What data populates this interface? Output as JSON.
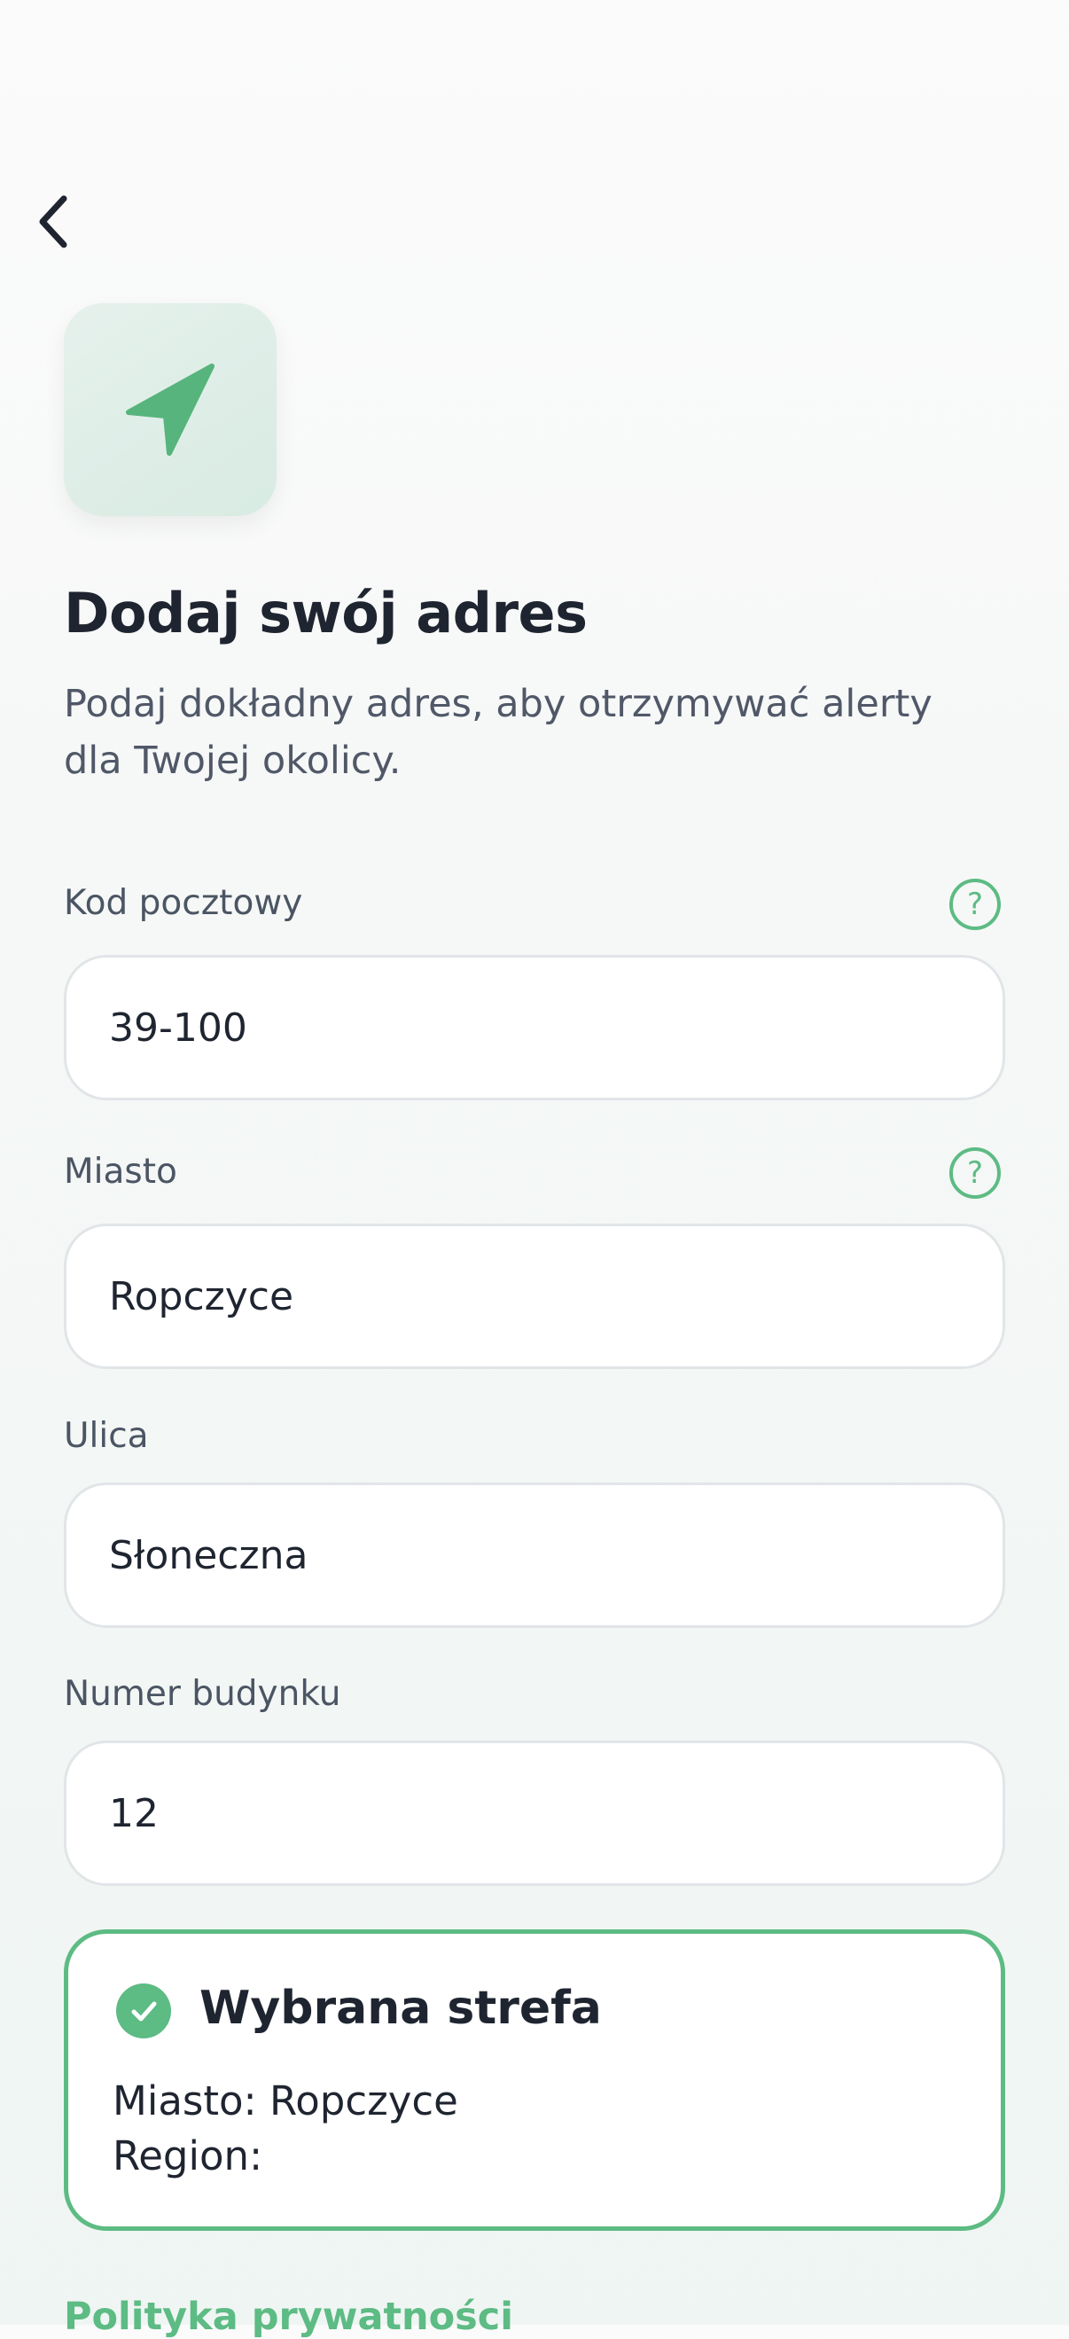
{
  "header": {
    "title": "Dodaj swój adres",
    "subtitle": "Podaj dokładny adres, aby otrzymywać alerty dla Twojej okolicy."
  },
  "form": {
    "postal_code": {
      "label": "Kod pocztowy",
      "value": "39-100"
    },
    "city": {
      "label": "Miasto",
      "value": "Ropczyce"
    },
    "street": {
      "label": "Ulica",
      "value": "Słoneczna"
    },
    "building_number": {
      "label": "Numer budynku",
      "value": "12"
    }
  },
  "zone": {
    "title": "Wybrana strefa",
    "city_line": "Miasto: Ropczyce",
    "region_line": "Region:"
  },
  "footer": {
    "privacy_link": "Polityka prywatności"
  },
  "icons": {
    "back": "chevron-left-icon",
    "location": "navigation-arrow-icon",
    "help": "question-circle-icon",
    "check": "check-circle-icon"
  },
  "colors": {
    "accent": "#5dbb84",
    "text": "#1f2530",
    "muted": "#505868"
  }
}
